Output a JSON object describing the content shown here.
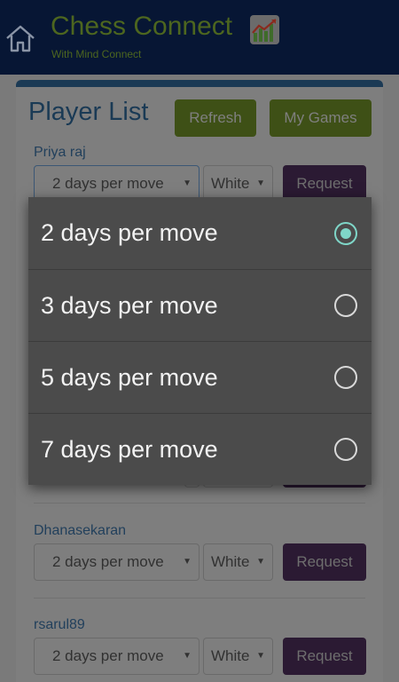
{
  "header": {
    "title": "Chess Connect",
    "subtitle": "With Mind Connect",
    "home_icon": "home-icon",
    "logo_icon": "bar-chart-icon"
  },
  "page": {
    "title": "Player List",
    "refresh_label": "Refresh",
    "my_games_label": "My Games"
  },
  "players": [
    {
      "name": "Priya raj",
      "time": "2 days per move",
      "color": "White",
      "request_label": "Request"
    },
    {
      "name": "Dhanasekaran",
      "time": "2 days per move",
      "color": "White",
      "request_label": "Request"
    },
    {
      "name": "rsarul89",
      "time": "2 days per move",
      "color": "White",
      "request_label": "Request"
    }
  ],
  "dropdown": {
    "options": [
      {
        "label": "2 days per move",
        "selected": true
      },
      {
        "label": "3 days per move",
        "selected": false
      },
      {
        "label": "5 days per move",
        "selected": false
      },
      {
        "label": "7 days per move",
        "selected": false
      }
    ]
  },
  "colors": {
    "header_bg": "#071634",
    "accent_green": "#7ba628",
    "request_purple": "#5c2a6e",
    "title_blue": "#2d6193",
    "radio_teal": "#7fd6c8"
  }
}
